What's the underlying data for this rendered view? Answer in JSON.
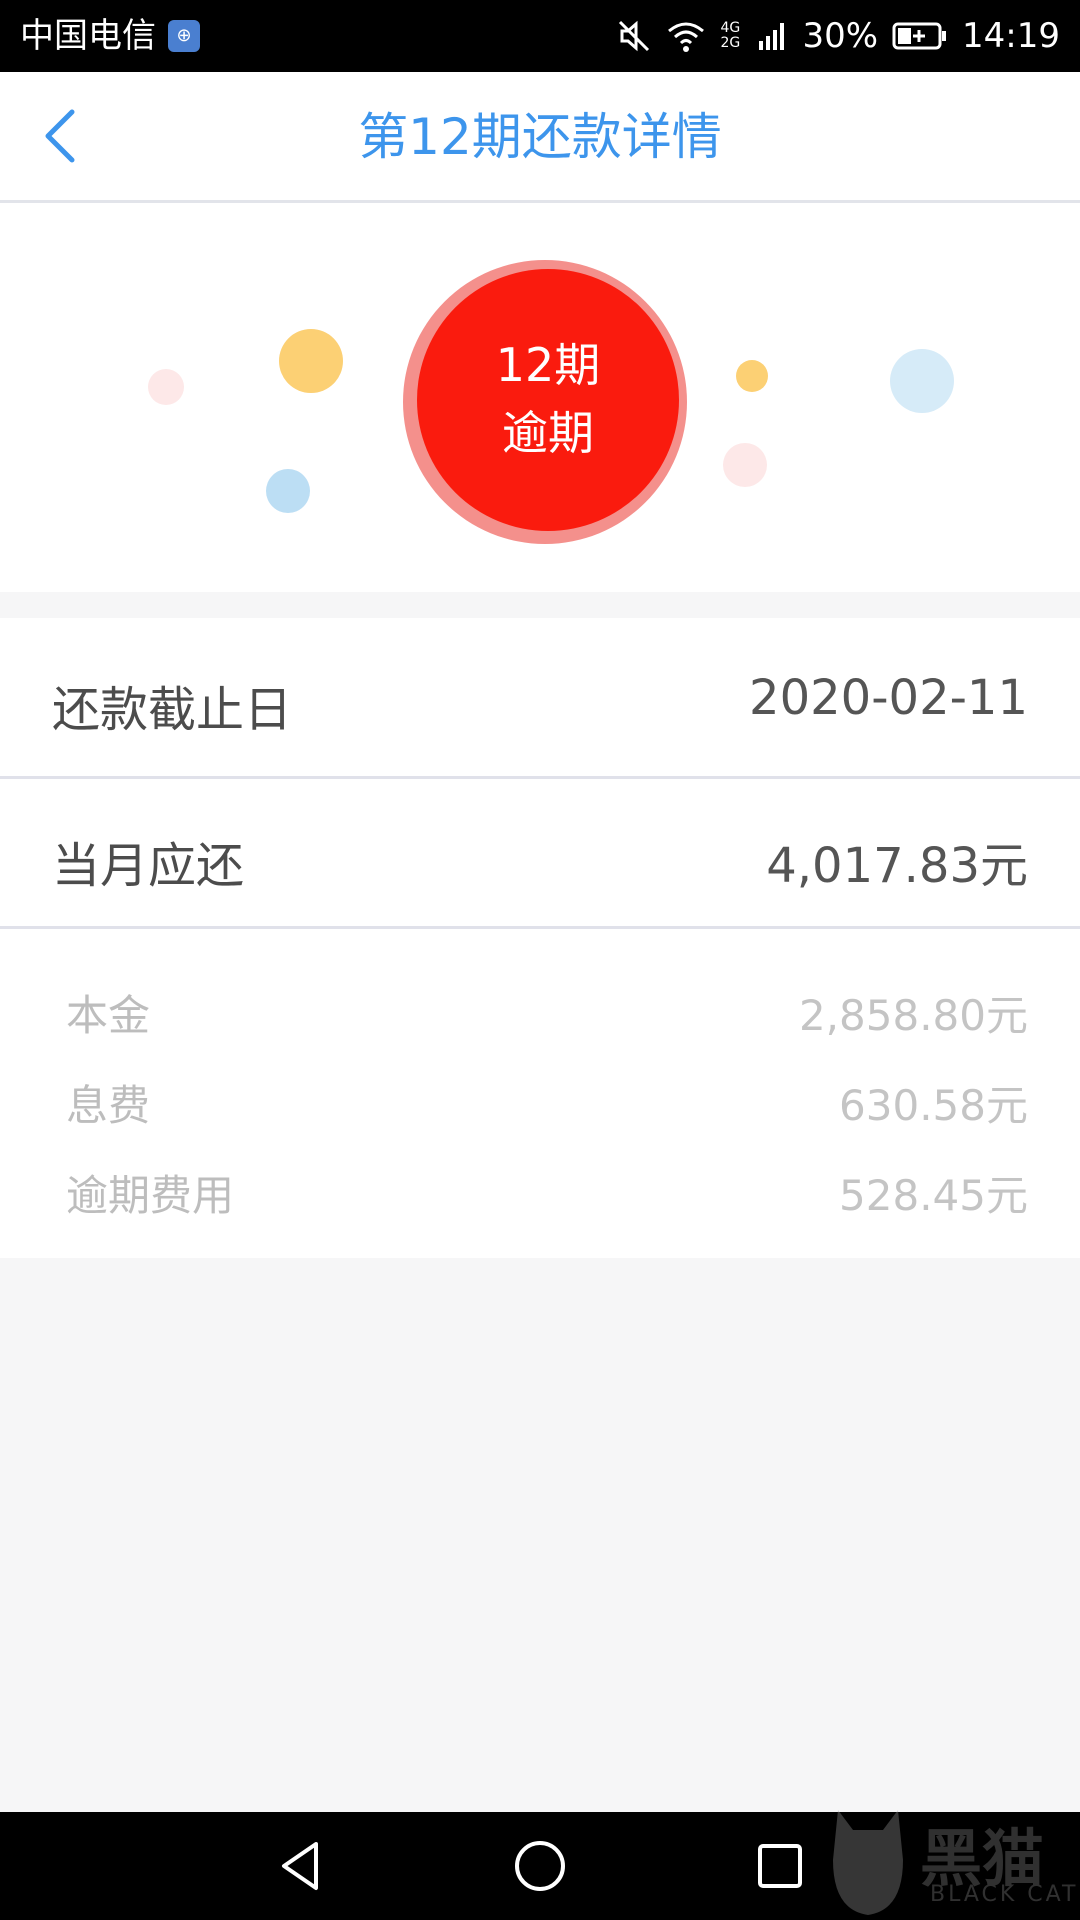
{
  "status_bar": {
    "carrier": "中国电信",
    "signal_types": "4G 2G",
    "battery_percent": "30%",
    "time": "14:19",
    "icons": [
      "mute-icon",
      "wifi-icon",
      "signal-icon",
      "battery-charging-icon"
    ]
  },
  "header": {
    "title": "第12期还款详情",
    "back_icon": "chevron-left-icon"
  },
  "hero": {
    "circle_line1": "12期",
    "circle_line2": "逾期",
    "colors": {
      "circle": "#fa1b0e",
      "ring": "#f4908c"
    }
  },
  "summary": {
    "due_date_label": "还款截止日",
    "due_date_value": "2020-02-11",
    "monthly_label": "当月应还",
    "monthly_value": "4,017.83元"
  },
  "breakdown": [
    {
      "label": "本金",
      "value": "2,858.80元"
    },
    {
      "label": "息费",
      "value": "630.58元"
    },
    {
      "label": "逾期费用",
      "value": "528.45元"
    }
  ],
  "watermark": {
    "brand": "黑猫",
    "sub": "BLACK CAT"
  },
  "theme": {
    "accent": "#3d95ec"
  }
}
